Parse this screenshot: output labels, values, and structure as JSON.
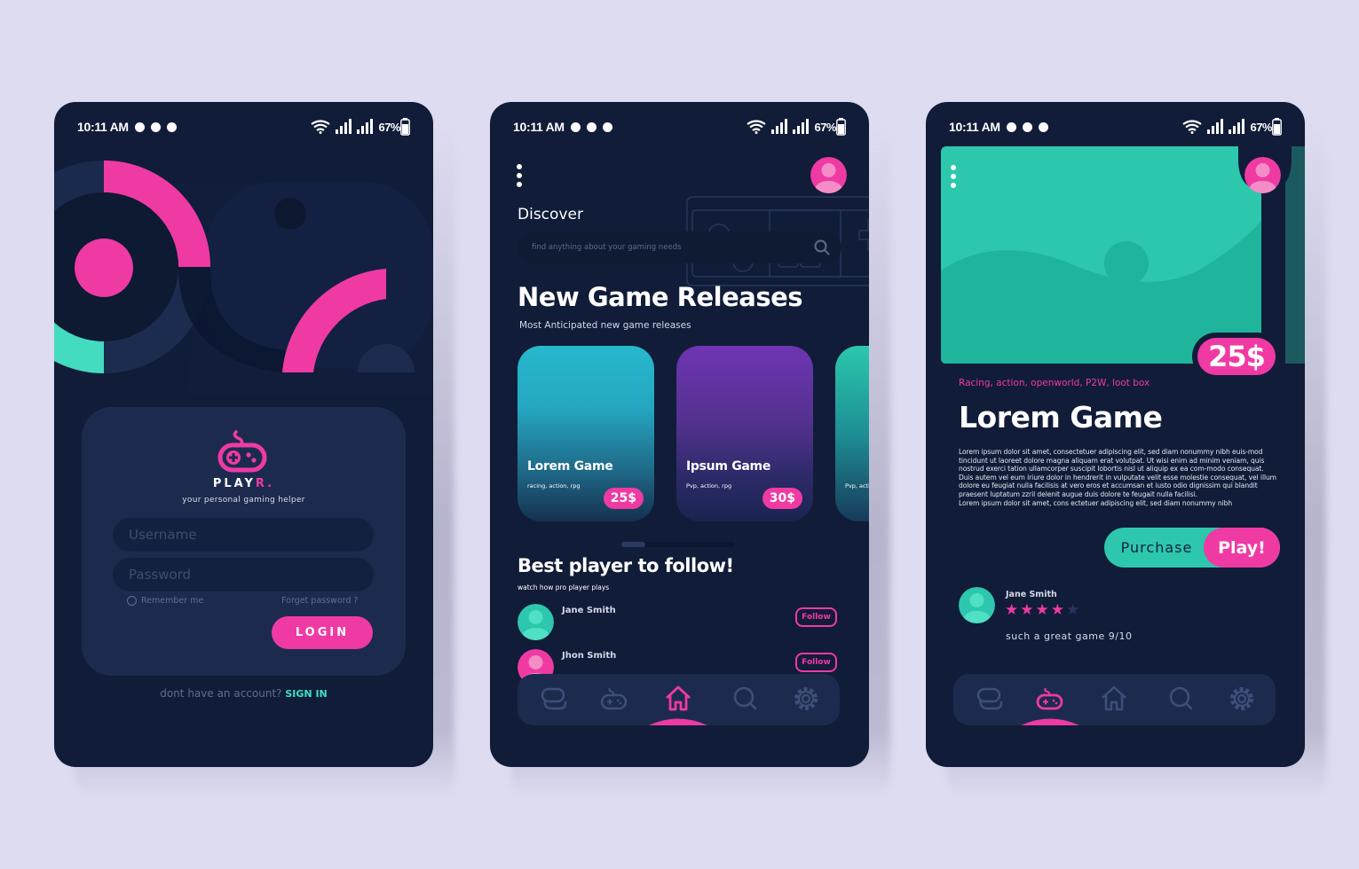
{
  "colors": {
    "background": "#dddcf1",
    "phone": "#111c38",
    "card": "#1c2b4d",
    "accent_pink": "#ef3aa4",
    "accent_teal": "#2cc7ad",
    "muted": "#5f6d92"
  },
  "status_bar": {
    "time": "10:11 AM",
    "battery": "67%",
    "icons": [
      "notification-dot-icon",
      "wifi-icon",
      "signal-icon",
      "battery-icon"
    ]
  },
  "login_screen": {
    "logo_icon": "gamepad-icon",
    "brand_main": "PLAY",
    "brand_accent": "R.",
    "tagline": "your personal gaming helper",
    "username_placeholder": "Username",
    "password_placeholder": "Password",
    "remember_me": "Remember me",
    "forgot_password": "Forget password ?",
    "login_button": "LOGIN",
    "no_account_text": "dont have an account?",
    "sign_in_link": "SIGN IN"
  },
  "discover_screen": {
    "menu_icon": "kebab-menu-icon",
    "profile_icon": "user-avatar-icon",
    "heading": "Discover",
    "search_placeholder": "find anything about your gaming needs",
    "new_releases_title": "New Game Releases",
    "new_releases_subtitle": "Most Anticipated  new game releases",
    "games": [
      {
        "title": "Lorem Game",
        "tags": "racing, action, rpg",
        "price": "25$"
      },
      {
        "title": "Ipsum Game",
        "tags": "Pvp, action, rpg",
        "price": "30$"
      },
      {
        "title": "",
        "tags": "Pvp, action, rpg",
        "price": ""
      }
    ],
    "carousel_position": 0.0,
    "best_players_title": "Best player to follow!",
    "best_players_subtitle": "watch how pro player plays",
    "players": [
      {
        "name": "Jane Smith",
        "follow_label": "Follow"
      },
      {
        "name": "Jhon Smith",
        "follow_label": "Follow"
      }
    ],
    "nav": {
      "items": [
        "chat-icon",
        "gamepad-icon",
        "home-icon",
        "search-icon",
        "settings-icon"
      ],
      "active": "home-icon"
    }
  },
  "detail_screen": {
    "menu_icon": "kebab-menu-icon",
    "profile_icon": "user-avatar-icon",
    "hero_image": "landscape-placeholder-image",
    "price": "25$",
    "tags": "Racing, action, openworld, P2W, loot box",
    "title": "Lorem Game",
    "description": "Lorem ipsum dolor sit amet, consectetuer adipiscing elit, sed diam nonummy nibh euis-mod tincidunt ut laoreet dolore magna aliquam erat volutpat. Ut wisi enim ad minim veniam, quis nostrud exerci tation ullamcorper suscipit lobortis nisl ut aliquip ex ea com-modo consequat. Duis autem vel eum iriure dolor in hendrerit in vulputate velit esse molestie consequat, vel illum dolore eu feugiat nulla facilisis at vero eros et accumsan et iusto odio dignissim qui blandit praesent luptatum zzril delenit augue duis dolore te feugait nulla facilisi.",
    "description_2": "Lorem ipsum dolor sit amet, cons ectetuer adipiscing elit, sed diam nonummy nibh",
    "purchase_label": "Purchase",
    "play_label": "Play!",
    "review": {
      "name": "Jane Smith",
      "rating": 4,
      "rating_max": 5,
      "text": "such a great game 9/10"
    },
    "nav": {
      "items": [
        "chat-icon",
        "gamepad-icon",
        "home-icon",
        "search-icon",
        "settings-icon"
      ],
      "active": "gamepad-icon"
    }
  }
}
